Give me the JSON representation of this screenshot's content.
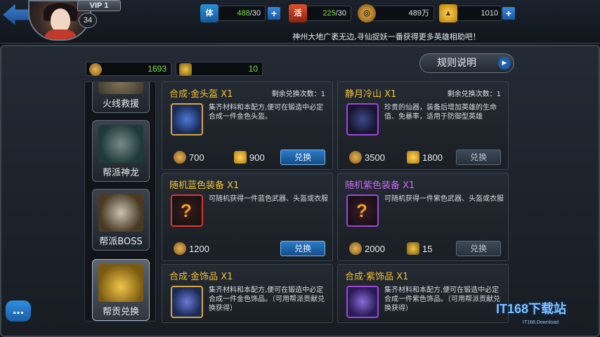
{
  "header": {
    "vip": "VIP 1",
    "level": "34",
    "stamina": {
      "icon": "stamina-icon",
      "glyph": "体",
      "value": "488",
      "max": "/30"
    },
    "energy": {
      "icon": "energy-icon",
      "glyph": "活",
      "value": "225",
      "max": "/30"
    },
    "coins": {
      "icon": "coin-icon",
      "value": "489万"
    },
    "ingots": {
      "icon": "ingot-icon",
      "value": "1010"
    },
    "plus": "+",
    "ticker": "神州大地广袤无边,寻仙捉妖一番获得更多英雄相助吧！"
  },
  "stats": {
    "contribution": "1693",
    "tokens": "10"
  },
  "rules_button": "规则说明",
  "nav": [
    {
      "label": "火线救援",
      "icon": "fire-rescue-icon"
    },
    {
      "label": "帮派神龙",
      "icon": "dragon-icon"
    },
    {
      "label": "帮派BOSS",
      "icon": "boss-icon"
    },
    {
      "label": "帮贡兑换",
      "icon": "treasure-icon"
    }
  ],
  "cards": [
    {
      "title": "合成·金头盔 X1",
      "remain": "剩余兑换次数：1",
      "icon": "helmet-recipe-icon",
      "desc": "集齐材料和本配方,便可在锻造中必定合成一件金色头盔。",
      "price1": "700",
      "price2": "900",
      "button": "兑换"
    },
    {
      "title": "静月冷山 X1",
      "remain": "剩余兑换次数：1",
      "icon": "boots-icon",
      "desc": "珍贵的仙器，装备后增加英雄的生命值、免暴率，适用于防御型英雄",
      "price1": "3500",
      "price2": "1800",
      "button": "兑换"
    },
    {
      "title": "随机蓝色装备 X1",
      "icon": "random-blue-equipment-icon",
      "desc": "可随机获得一件蓝色武器、头盔或衣服",
      "price1": "1200",
      "button": "兑换"
    },
    {
      "title": "随机紫色装备 X1",
      "icon": "random-purple-equipment-icon",
      "desc": "可随机获得一件紫色武器、头盔或衣服",
      "price1": "2000",
      "price2": "15",
      "button": "兑换"
    },
    {
      "title": "合成·金饰品 X1",
      "icon": "gold-accessory-recipe-icon",
      "desc": "集齐材料和本配方,便可在锻造中必定合成一件金色饰品。（可用帮派贡献兑换获得）"
    },
    {
      "title": "合成·紫饰品 X1",
      "icon": "purple-accessory-recipe-icon",
      "desc": "集齐材料和本配方,便可在锻造中必定合成一件紫色饰品。（可用帮派贡献兑换获得）"
    }
  ],
  "watermark": {
    "main": "IT168下载站",
    "sub": "IT168.Download"
  },
  "colors": {
    "gold_title": "#f2c232",
    "purple_title": "#c56cf0",
    "green_value": "#7be03f",
    "button_blue": "#2c7bc8"
  }
}
